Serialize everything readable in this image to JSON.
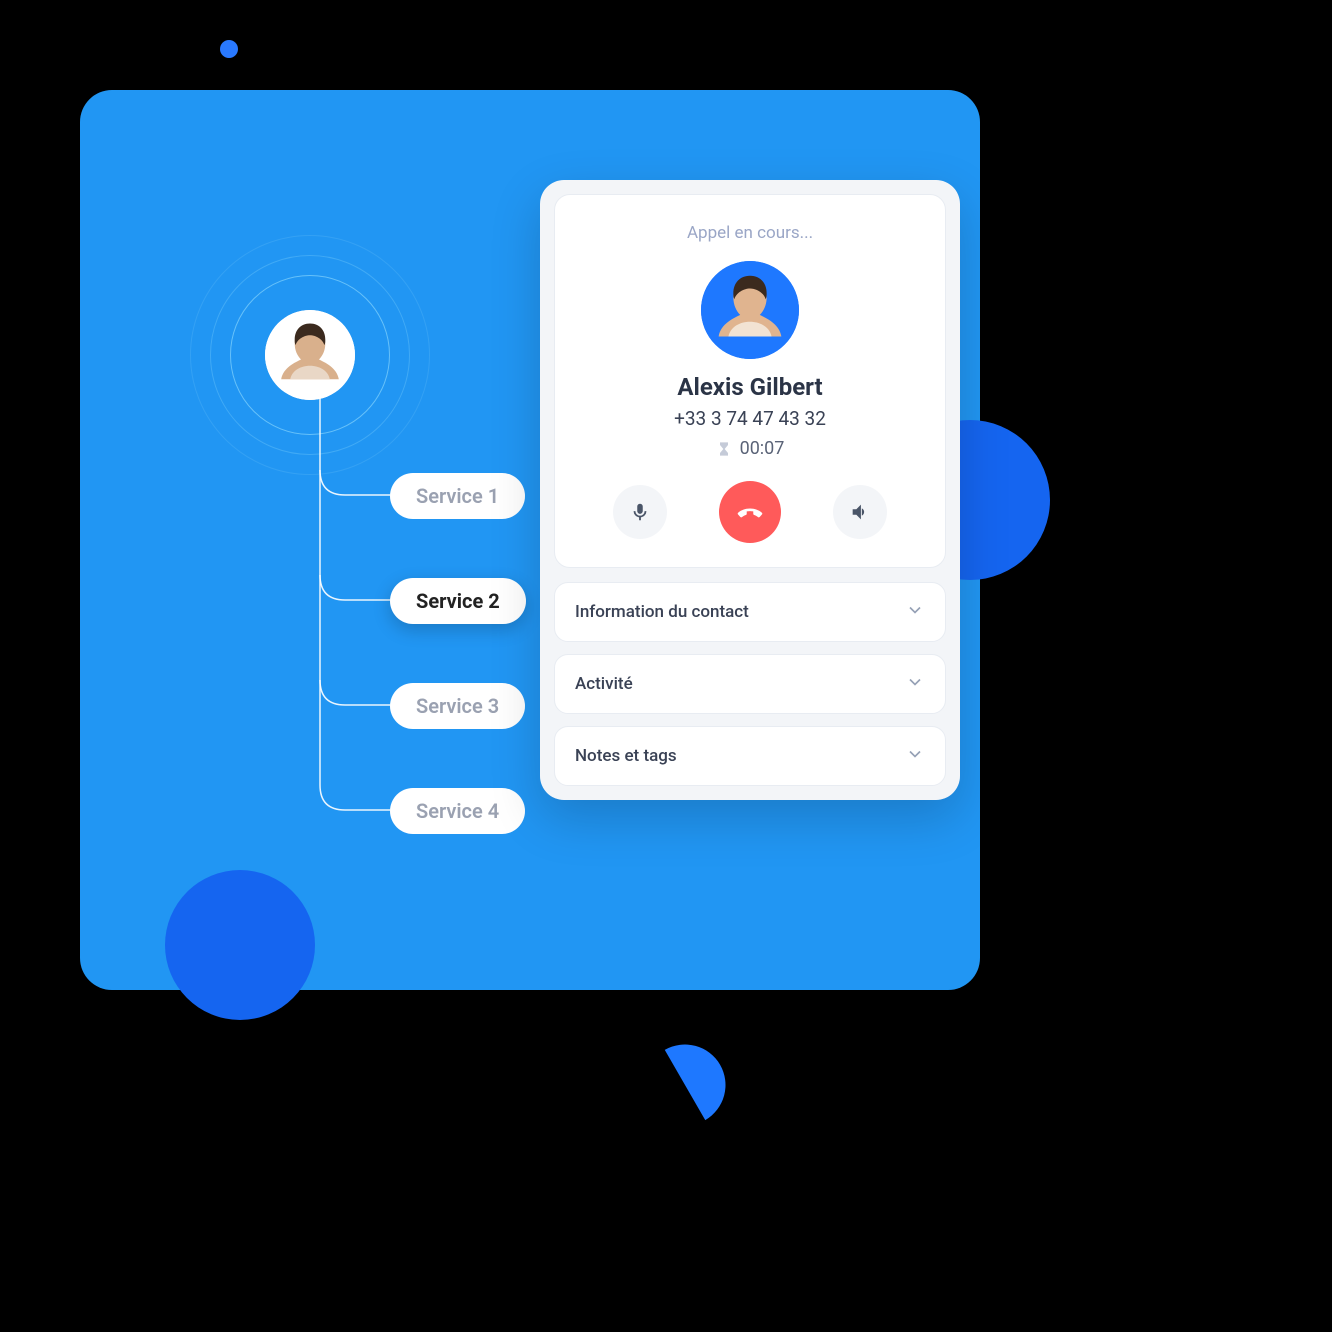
{
  "services": {
    "items": [
      {
        "label": "Service 1",
        "active": false
      },
      {
        "label": "Service 2",
        "active": true
      },
      {
        "label": "Service 3",
        "active": false
      },
      {
        "label": "Service 4",
        "active": false
      }
    ]
  },
  "call": {
    "status": "Appel en cours...",
    "name": "Alexis Gilbert",
    "phone": "+33 3 74 47 43 32",
    "duration": "00:07"
  },
  "accordion": {
    "items": [
      {
        "label": "Information du contact"
      },
      {
        "label": "Activité"
      },
      {
        "label": "Notes et tags"
      }
    ]
  },
  "colors": {
    "brand_blue": "#2196f3",
    "deep_blue": "#1565f0",
    "hangup_red": "#ff5a5a"
  }
}
